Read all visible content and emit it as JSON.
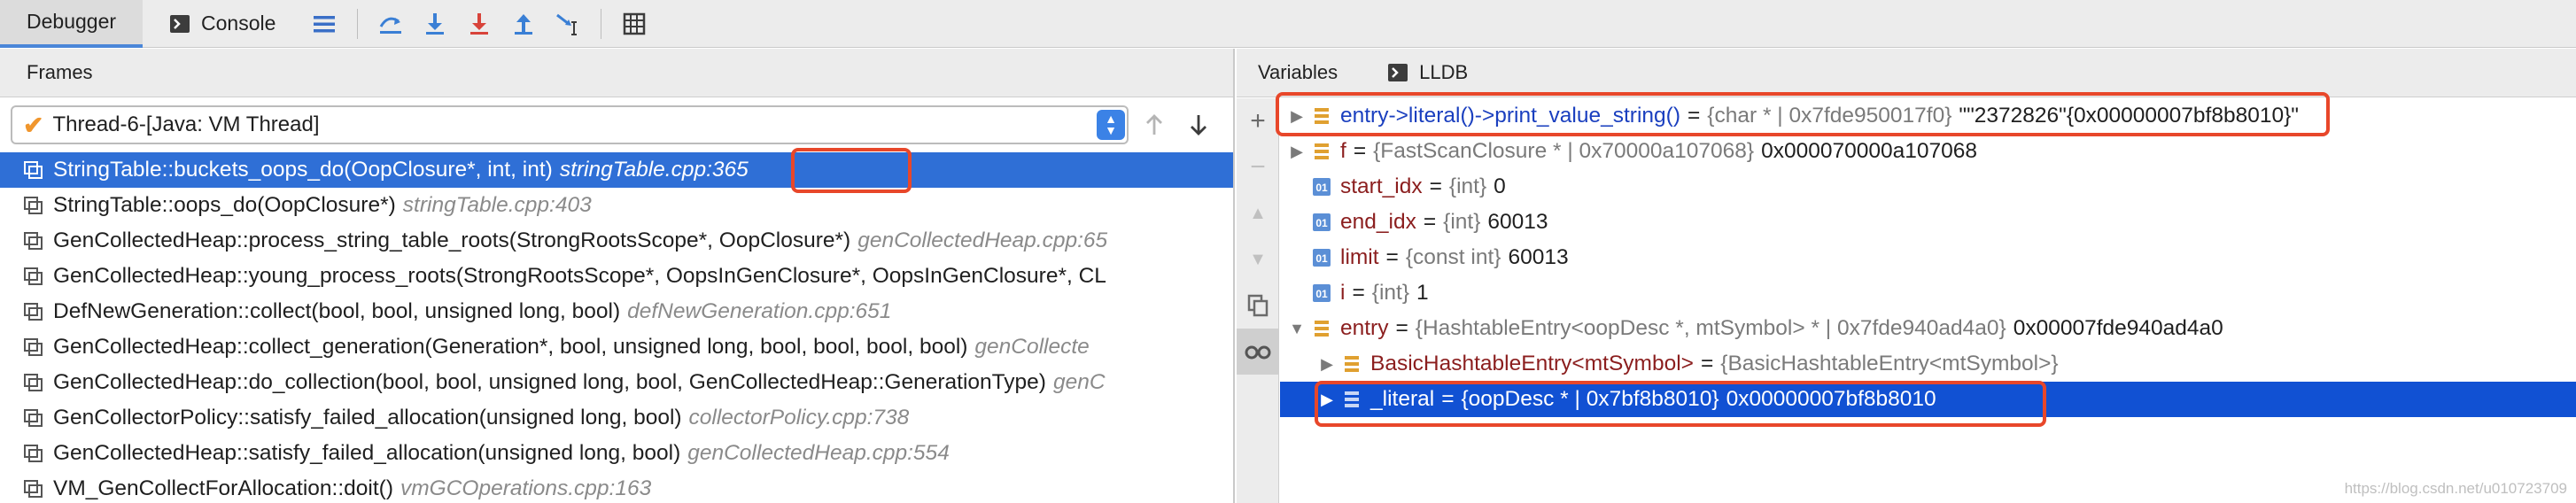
{
  "toolbar": {
    "tabs": [
      {
        "label": "Debugger",
        "active": true
      },
      {
        "label": "Console",
        "icon": "console-icon"
      }
    ],
    "icons": [
      "hamburger-icon",
      "show-execution-point-icon",
      "step-over-icon",
      "step-into-icon",
      "force-step-into-icon",
      "step-out-icon",
      "run-to-cursor-icon",
      "evaluate-expression-icon"
    ]
  },
  "frames_panel": {
    "title": "Frames",
    "thread": "Thread-6-[Java: VM Thread]",
    "frames": [
      {
        "func": "StringTable::buckets_oops_do(OopClosure*, int, int)",
        "file": "stringTable.cpp:365",
        "selected": true
      },
      {
        "func": "StringTable::oops_do(OopClosure*)",
        "file": "stringTable.cpp:403"
      },
      {
        "func": "GenCollectedHeap::process_string_table_roots(StrongRootsScope*, OopClosure*)",
        "file": "genCollectedHeap.cpp:65"
      },
      {
        "func": "GenCollectedHeap::young_process_roots(StrongRootsScope*, OopsInGenClosure*, OopsInGenClosure*, CL",
        "file": ""
      },
      {
        "func": "DefNewGeneration::collect(bool, bool, unsigned long, bool)",
        "file": "defNewGeneration.cpp:651"
      },
      {
        "func": "GenCollectedHeap::collect_generation(Generation*, bool, unsigned long, bool, bool, bool, bool)",
        "file": "genCollecte"
      },
      {
        "func": "GenCollectedHeap::do_collection(bool, bool, unsigned long, bool, GenCollectedHeap::GenerationType)",
        "file": "genC"
      },
      {
        "func": "GenCollectorPolicy::satisfy_failed_allocation(unsigned long, bool)",
        "file": "collectorPolicy.cpp:738"
      },
      {
        "func": "GenCollectedHeap::satisfy_failed_allocation(unsigned long, bool)",
        "file": "genCollectedHeap.cpp:554"
      },
      {
        "func": "VM_GenCollectForAllocation::doit()",
        "file": "vmGCOperations.cpp:163"
      }
    ]
  },
  "variables_panel": {
    "tabs": [
      {
        "label": "Variables",
        "active": true
      },
      {
        "label": "LLDB",
        "icon": "console-icon"
      }
    ],
    "variables": [
      {
        "indent": 0,
        "expand": "▶",
        "icon": "watch-icon",
        "name": "entry->literal()->print_value_string()",
        "name_color": "blue",
        "type": "{char * | 0x7fde950017f0}",
        "value": "\"\"2372826\"{0x00000007bf8b8010}\""
      },
      {
        "indent": 0,
        "expand": "▶",
        "icon": "field-icon",
        "name": "f",
        "type": "{FastScanClosure * | 0x70000a107068}",
        "value": "0x000070000a107068"
      },
      {
        "indent": 0,
        "expand": "",
        "icon": "primitive-icon",
        "name": "start_idx",
        "type": "{int}",
        "value": "0"
      },
      {
        "indent": 0,
        "expand": "",
        "icon": "primitive-icon",
        "name": "end_idx",
        "type": "{int}",
        "value": "60013"
      },
      {
        "indent": 0,
        "expand": "",
        "icon": "primitive-icon",
        "name": "limit",
        "type": "{const int}",
        "value": "60013"
      },
      {
        "indent": 0,
        "expand": "",
        "icon": "primitive-icon",
        "name": "i",
        "type": "{int}",
        "value": "1"
      },
      {
        "indent": 0,
        "expand": "▼",
        "icon": "field-icon",
        "name": "entry",
        "type": "{HashtableEntry<oopDesc *, mtSymbol> * | 0x7fde940ad4a0}",
        "value": "0x00007fde940ad4a0"
      },
      {
        "indent": 1,
        "expand": "▶",
        "icon": "field-icon",
        "name": "BasicHashtableEntry<mtSymbol>",
        "type": "{BasicHashtableEntry<mtSymbol>}",
        "value": ""
      },
      {
        "indent": 1,
        "expand": "▶",
        "icon": "field-icon",
        "name": "_literal",
        "type": "{oopDesc * | 0x7bf8b8010}",
        "value": "0x00000007bf8b8010",
        "selected": true
      }
    ]
  },
  "watermark": "https://blog.csdn.net/u010723709",
  "colors": {
    "selection": "#2f6fd6",
    "selection_dark": "#1151d3",
    "highlight": "#e8472a",
    "accent": "#4a86d8"
  }
}
